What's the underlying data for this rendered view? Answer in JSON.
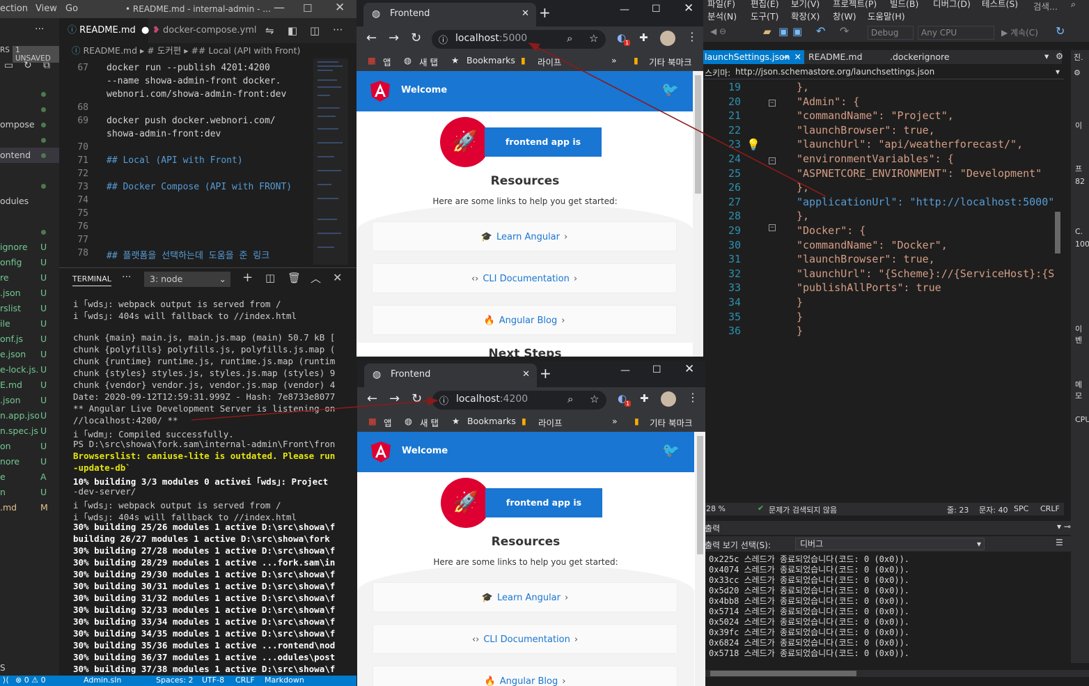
{
  "vscode": {
    "title_menu": [
      "ection",
      "View",
      "Go"
    ],
    "window_title": "• README.md - internal-admin - ...",
    "unsaved": "1 UNSAVED",
    "explorer_label": "RS",
    "sidebar_files": [
      {
        "name": "",
        "status": "dot"
      },
      {
        "name": "",
        "status": "dot"
      },
      {
        "name": "ompose",
        "status": "dot"
      },
      {
        "name": "",
        "status": "dot"
      },
      {
        "name": "ontend",
        "status": "dot"
      },
      {
        "name": "",
        "status": ""
      },
      {
        "name": "",
        "status": "dot"
      },
      {
        "name": "odules",
        "status": ""
      },
      {
        "name": "",
        "status": ""
      },
      {
        "name": "",
        "status": "dot"
      },
      {
        "name": "ignore",
        "status": "U"
      },
      {
        "name": "onfig",
        "status": "U"
      },
      {
        "name": "re",
        "status": "U"
      },
      {
        "name": ".json",
        "status": "U"
      },
      {
        "name": "rslist",
        "status": "U"
      },
      {
        "name": "ile",
        "status": "U"
      },
      {
        "name": "onf.js",
        "status": "U"
      },
      {
        "name": "e.json",
        "status": "U"
      },
      {
        "name": "e-lock.js...",
        "status": "U"
      },
      {
        "name": "E.md",
        "status": "U"
      },
      {
        "name": ".json",
        "status": "U"
      },
      {
        "name": "n.app.json",
        "status": "U"
      },
      {
        "name": "n.spec.js...",
        "status": "U"
      },
      {
        "name": "on",
        "status": "U"
      },
      {
        "name": "nore",
        "status": "U"
      },
      {
        "name": "e",
        "status": "A"
      },
      {
        "name": "n",
        "status": "U"
      },
      {
        "name": ".md",
        "status": "M"
      }
    ],
    "tabs": [
      {
        "label": "README.md",
        "active": true
      },
      {
        "label": "docker-compose.yml",
        "active": false
      }
    ],
    "breadcrumb": [
      "README.md",
      "# 도커편",
      "## Local (API with Front)"
    ],
    "editor_lines": [
      {
        "no": "67",
        "text": "    docker run --publish 4201:4200"
      },
      {
        "no": "",
        "text": "    --name showa-admin-front docker."
      },
      {
        "no": "",
        "text": "    webnori.com/showa-admin-front:dev"
      },
      {
        "no": "68",
        "text": ""
      },
      {
        "no": "69",
        "text": "    docker push docker.webnori.com/"
      },
      {
        "no": "",
        "text": "    showa-admin-front:dev"
      },
      {
        "no": "70",
        "text": ""
      },
      {
        "no": "71",
        "text": "## Local (API with Front)"
      },
      {
        "no": "72",
        "text": ""
      },
      {
        "no": "73",
        "text": "## Docker Compose (API with FRONT)"
      },
      {
        "no": "74",
        "text": ""
      },
      {
        "no": "75",
        "text": ""
      },
      {
        "no": "76",
        "text": ""
      },
      {
        "no": "77",
        "text": ""
      },
      {
        "no": "78",
        "text": "## 플랫폼을 선택하는데 도움을 준 링크"
      }
    ],
    "terminal_tab": "TERMINAL",
    "terminal_select": "3: node",
    "terminal_lines": [
      "i ｢wds｣: webpack output is served from /",
      "i ｢wds｣: 404s will fallback to //index.html",
      "",
      "chunk {main} main.js, main.js.map (main) 50.7 kB [",
      "chunk {polyfills} polyfills.js, polyfills.js.map (",
      "chunk {runtime} runtime.js, runtime.js.map (runtim",
      "chunk {styles} styles.js, styles.js.map (styles) 9",
      "chunk {vendor} vendor.js, vendor.js.map (vendor) 4",
      "Date: 2020-09-12T12:59:31.999Z - Hash: 7e8733e8077",
      "** Angular Live Development Server is listening on",
      "//localhost:4200/ **",
      "i ｢wdm｣: Compiled successfully.",
      "PS D:\\src\\showa\\fork.sam\\internal-admin\\Front\\fron",
      "Browserslist: caniuse-lite is outdated. Please run",
      "-update-db`",
      "10% building 3/3 modules 0 activei ｢wds｣: Project",
      "-dev-server/",
      "i ｢wds｣: webpack output is served from /",
      "i ｢wds｣: 404s will fallback to //index.html",
      "30% building 25/26 modules 1 active D:\\src\\showa\\f",
      " building 26/27 modules 1 active D:\\src\\showa\\fork",
      "30% building 27/28 modules 1 active D:\\src\\showa\\f",
      "30% building 28/29 modules 1 active ...fork.sam\\in",
      "30% building 29/30 modules 1 active D:\\src\\showa\\f",
      "30% building 30/31 modules 1 active D:\\src\\showa\\f",
      "30% building 31/32 modules 1 active D:\\src\\showa\\f",
      "30% building 32/33 modules 1 active D:\\src\\showa\\f",
      "30% building 33/34 modules 1 active D:\\src\\showa\\f",
      "30% building 34/35 modules 1 active D:\\src\\showa\\f",
      "30% building 35/36 modules 1 active ...rontend\\nod",
      "30% building 36/37 modules 1 active ...odules\\post",
      "30% building 37/38 modules 1 active D:\\src\\showa\\f"
    ],
    "status": {
      "problems": "⊗ 0 ⚠ 0",
      "solution": "Admin.sln",
      "spaces": "Spaces: 2",
      "encoding": "UTF-8",
      "eol": "CRLF",
      "lang": "Markdown"
    },
    "bottom_left": "S"
  },
  "browser1": {
    "tab_title": "Frontend",
    "url_host": "localhost",
    "url_port": ":5000",
    "bookmarks": [
      "앱",
      "새 탭",
      "Bookmarks",
      "라이프",
      "»",
      "기타 북마크"
    ],
    "badge": "1",
    "page": {
      "welcome": "Welcome",
      "running": "frontend app is running!",
      "resources": "Resources",
      "subtitle": "Here are some links to help you get started:",
      "cards": [
        "Learn Angular",
        "CLI Documentation",
        "Angular Blog"
      ],
      "next": "Next Steps"
    }
  },
  "browser2": {
    "tab_title": "Frontend",
    "url_host": "localhost",
    "url_port": ":4200",
    "bookmarks": [
      "앱",
      "새 탭",
      "Bookmarks",
      "라이프",
      "»",
      "기타 북마크"
    ],
    "badge": "1",
    "page": {
      "welcome": "Welcome",
      "running": "frontend app is running!",
      "resources": "Resources",
      "subtitle": "Here are some links to help you get started:",
      "cards": [
        "Learn Angular",
        "CLI Documentation",
        "Angular Blog"
      ]
    }
  },
  "vs": {
    "menu_row1": [
      "파일(F)",
      "편집(E)",
      "보기(V)",
      "프로젝트(P)",
      "빌드(B)",
      "디버그(D)",
      "테스트(S)"
    ],
    "search": "검색...",
    "menu_row2": [
      "분석(N)",
      "도구(T)",
      "확장(X)",
      "창(W)",
      "도움말(H)"
    ],
    "config": "Debug",
    "platform": "Any CPU",
    "run_label": "계속(C)",
    "tabs": [
      {
        "label": "launchSettings.json",
        "active": true
      },
      {
        "label": "README.md",
        "active": false
      },
      {
        "label": ".dockerignore",
        "active": false
      }
    ],
    "schema_label": "스키마:",
    "schema_url": "http://json.schemastore.org/launchsettings.json",
    "json_lines": [
      {
        "no": "19",
        "t": "    },"
      },
      {
        "no": "20",
        "t": "    \"Admin\": {"
      },
      {
        "no": "21",
        "t": "      \"commandName\": \"Project\","
      },
      {
        "no": "22",
        "t": "      \"launchBrowser\": true,"
      },
      {
        "no": "23",
        "t": "      \"launchUrl\": \"api/weatherforecast/\","
      },
      {
        "no": "24",
        "t": "      \"environmentVariables\": {"
      },
      {
        "no": "25",
        "t": "        \"ASPNETCORE_ENVIRONMENT\": \"Development\""
      },
      {
        "no": "26",
        "t": "      },"
      },
      {
        "no": "27",
        "t": "      \"applicationUrl\": \"http://localhost:5000\""
      },
      {
        "no": "28",
        "t": "    },"
      },
      {
        "no": "29",
        "t": "    \"Docker\": {"
      },
      {
        "no": "30",
        "t": "      \"commandName\": \"Docker\","
      },
      {
        "no": "31",
        "t": "      \"launchBrowser\": true,"
      },
      {
        "no": "32",
        "t": "      \"launchUrl\": \"{Scheme}://{ServiceHost}:{S"
      },
      {
        "no": "33",
        "t": "      \"publishAllPorts\": true"
      },
      {
        "no": "34",
        "t": "    }"
      },
      {
        "no": "35",
        "t": "  }"
      },
      {
        "no": "36",
        "t": "}"
      }
    ],
    "zoom": "28 %",
    "issues": "문제가 검색되지 않음",
    "line": "줄: 23",
    "col": "문자: 40",
    "spc": "SPC",
    "crlf": "CRLF",
    "output_title": "출력",
    "output_select_label": "출력 보기 선택(S):",
    "output_select": "디버그",
    "output_lines": [
      "0x225c 스레드가 종료되었습니다(코드: 0 (0x0)).",
      "0x4074 스레드가 종료되었습니다(코드: 0 (0x0)).",
      "0x33cc 스레드가 종료되었습니다(코드: 0 (0x0)).",
      "0x5d20 스레드가 종료되었습니다(코드: 0 (0x0)).",
      "0x4bb8 스레드가 종료되었습니다(코드: 0 (0x0)).",
      "0x5714 스레드가 종료되었습니다(코드: 0 (0x0)).",
      "0x5024 스레드가 종료되었습니다(코드: 0 (0x0)).",
      "0x39fc 스레드가 종료되었습니다(코드: 0 (0x0)).",
      "0x6824 스레드가 종료되었습니다(코드: 0 (0x0)).",
      "0x5718 스레드가 종료되었습니다(코드: 0 (0x0))."
    ],
    "right_panel": [
      "진.",
      "이",
      "프",
      "82",
      "C.",
      "100",
      "이벤",
      "메모",
      "CPU"
    ]
  },
  "colors": {
    "vscode_blue": "#007acc",
    "angular_red": "#dd0031",
    "angular_blue": "#1976d2",
    "arrow": "#8b1a1a"
  }
}
